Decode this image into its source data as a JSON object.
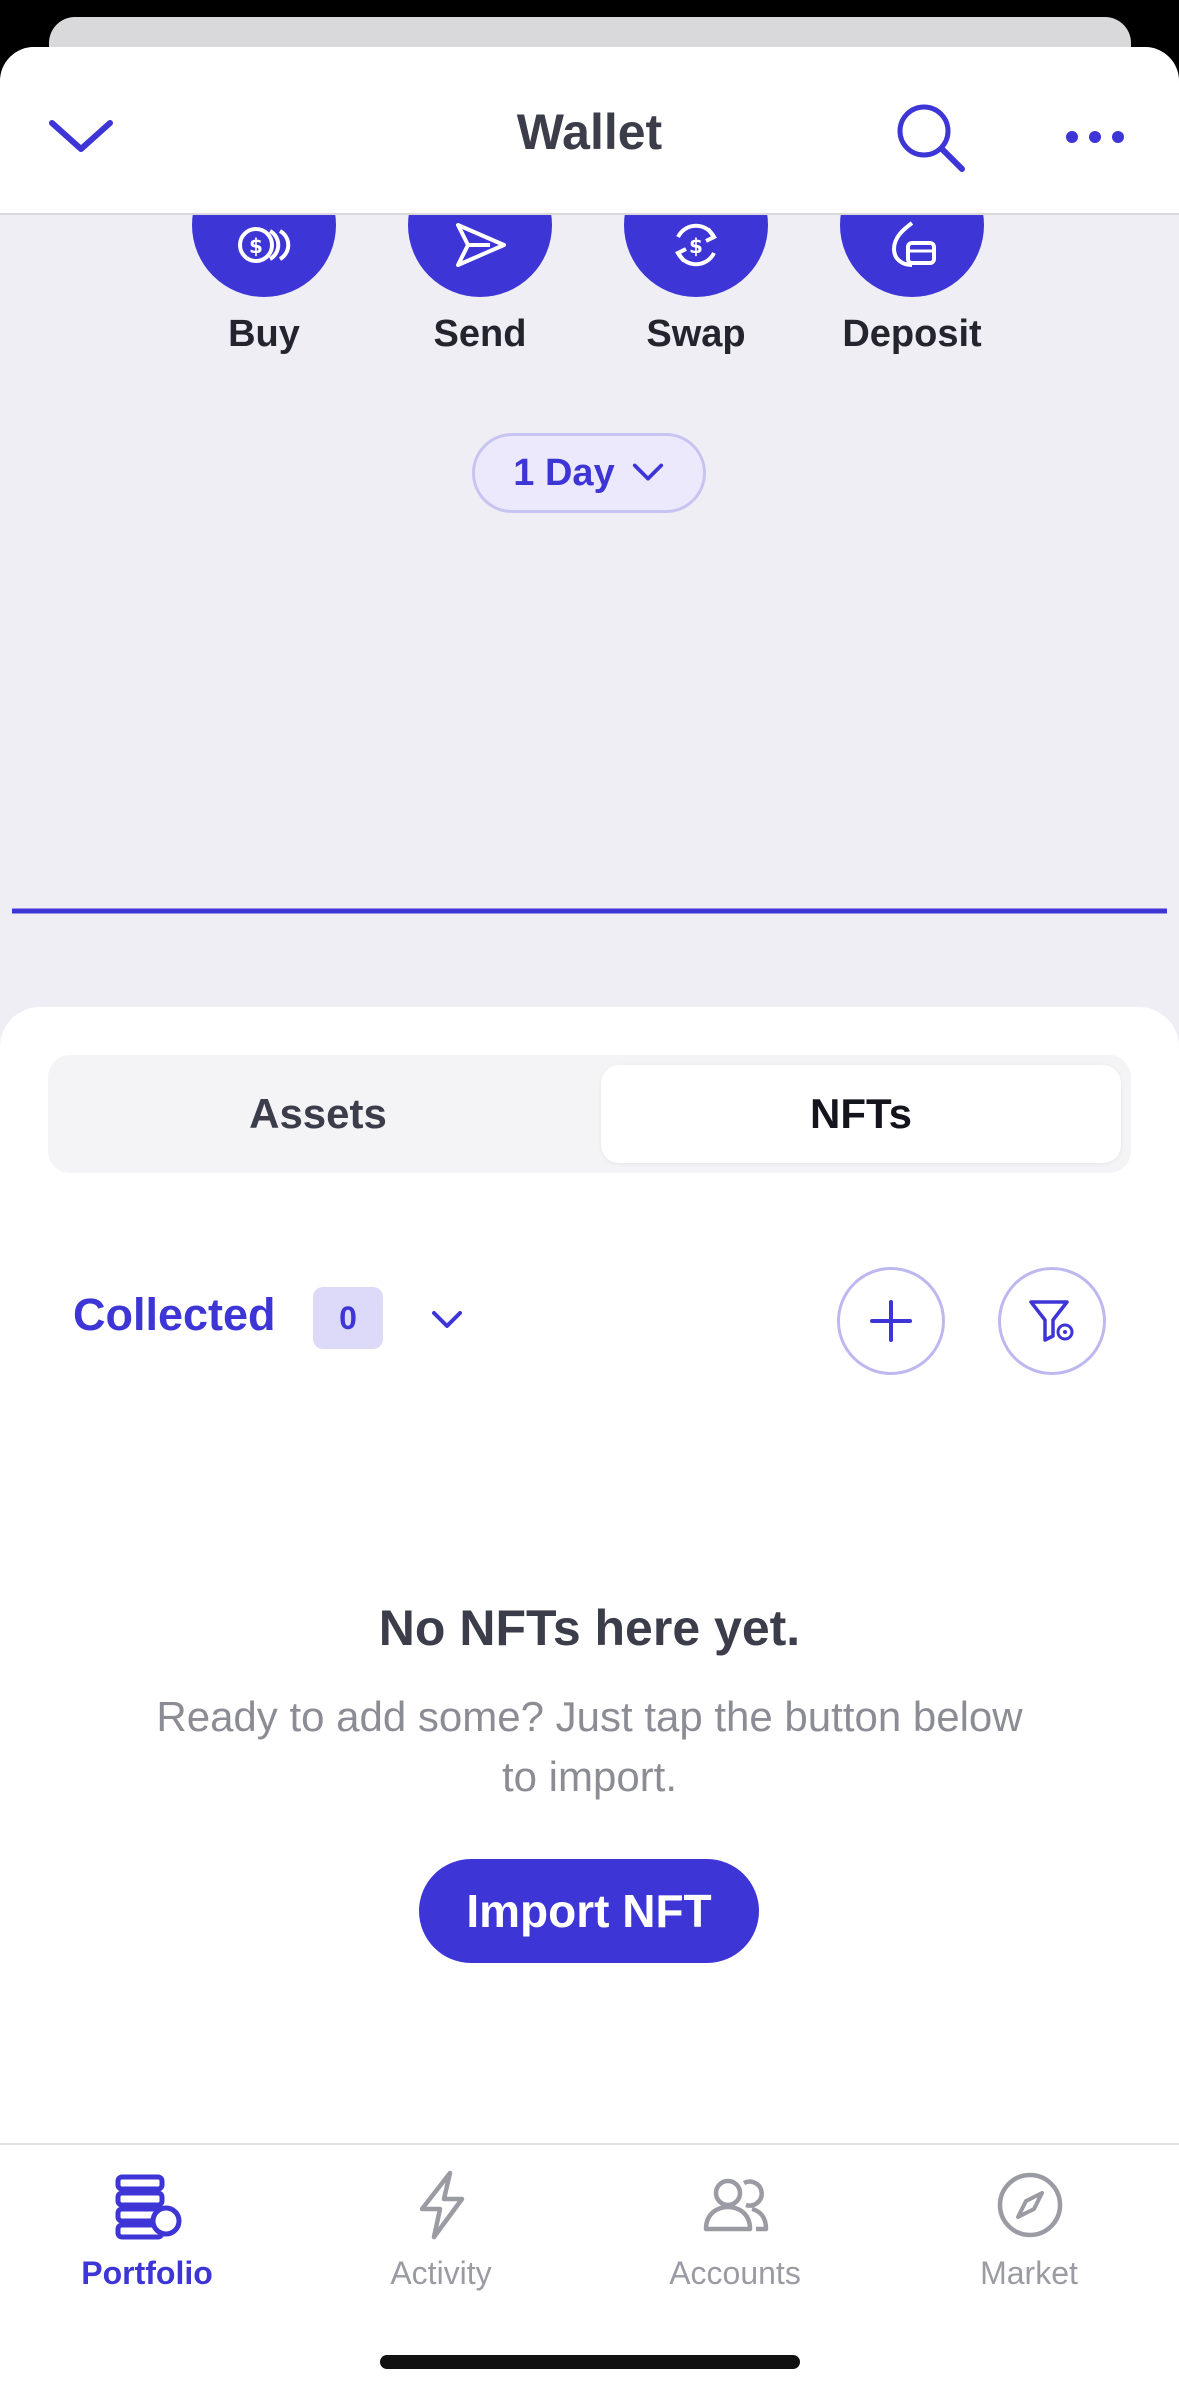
{
  "header": {
    "title": "Wallet"
  },
  "actions": [
    {
      "label": "Buy",
      "icon": "coins-icon"
    },
    {
      "label": "Send",
      "icon": "send-icon"
    },
    {
      "label": "Swap",
      "icon": "swap-icon"
    },
    {
      "label": "Deposit",
      "icon": "deposit-icon"
    }
  ],
  "range": {
    "label": "1 Day"
  },
  "tabs": [
    {
      "label": "Assets",
      "active": false
    },
    {
      "label": "NFTs",
      "active": true
    }
  ],
  "filter": {
    "label": "Collected",
    "count": "0"
  },
  "empty_state": {
    "title": "No NFTs here yet.",
    "subtitle": "Ready to add some? Just tap the button below to import.",
    "button": "Import NFT"
  },
  "nav": [
    {
      "label": "Portfolio",
      "active": true
    },
    {
      "label": "Activity",
      "active": false
    },
    {
      "label": "Accounts",
      "active": false
    },
    {
      "label": "Market",
      "active": false
    }
  ],
  "colors": {
    "accent": "#3d35d6",
    "background": "#efeef5"
  }
}
